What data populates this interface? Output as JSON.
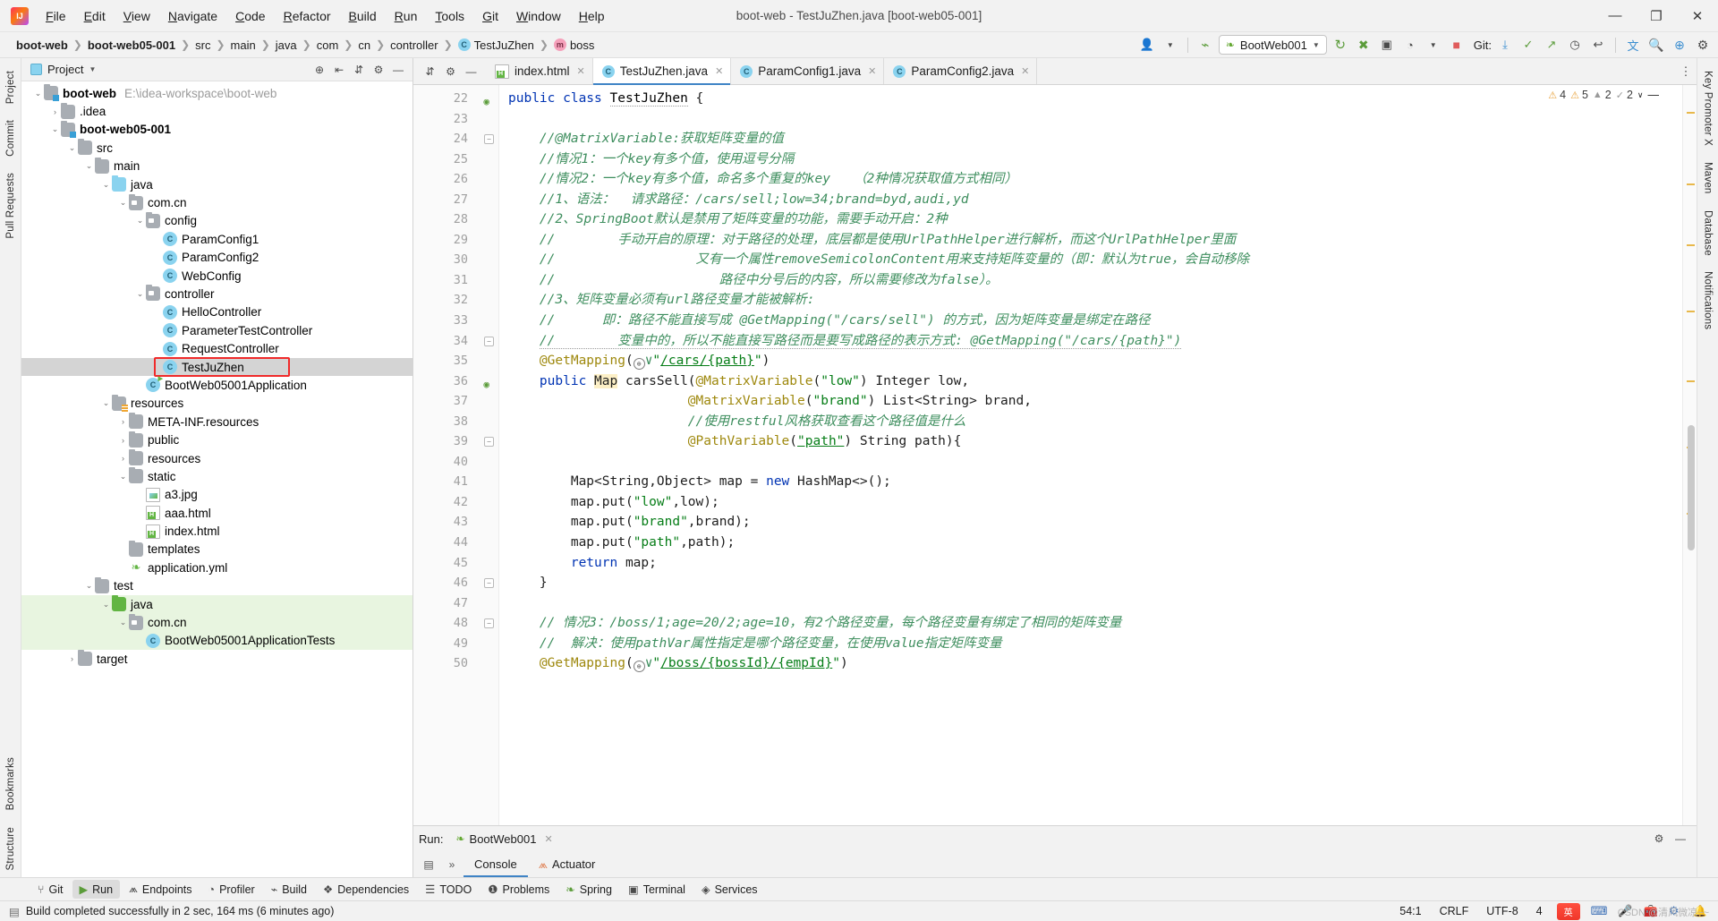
{
  "window": {
    "title": "boot-web - TestJuZhen.java [boot-web05-001]",
    "minimize": "—",
    "maximize": "❐",
    "close": "✕"
  },
  "menu": [
    "File",
    "Edit",
    "View",
    "Navigate",
    "Code",
    "Refactor",
    "Build",
    "Run",
    "Tools",
    "Git",
    "Window",
    "Help"
  ],
  "breadcrumb": [
    {
      "label": "boot-web",
      "bold": true,
      "icon": ""
    },
    {
      "label": "boot-web05-001",
      "bold": true,
      "icon": ""
    },
    {
      "label": "src",
      "bold": false,
      "icon": ""
    },
    {
      "label": "main",
      "bold": false,
      "icon": ""
    },
    {
      "label": "java",
      "bold": false,
      "icon": ""
    },
    {
      "label": "com",
      "bold": false,
      "icon": ""
    },
    {
      "label": "cn",
      "bold": false,
      "icon": ""
    },
    {
      "label": "controller",
      "bold": false,
      "icon": ""
    },
    {
      "label": "TestJuZhen",
      "bold": false,
      "icon": "class-icon"
    },
    {
      "label": "boss",
      "bold": false,
      "icon": "method-icon"
    }
  ],
  "toolbar": {
    "run_config": "BootWeb001",
    "git_label": "Git:",
    "icons": [
      "user-icon",
      "chevron-down-icon",
      "build-hammer-icon",
      "rerun-icon",
      "debug-icon",
      "run-with-coverage-icon",
      "profiler-icon",
      "chevron-down-icon",
      "stop-icon",
      "git-update-icon",
      "git-commit-icon",
      "git-push-icon",
      "history-icon",
      "rollback-icon",
      "translate-icon",
      "search-icon",
      "plugin-icon",
      "settings-icon"
    ]
  },
  "project_panel": {
    "title": "Project",
    "header_icons": [
      "target-icon",
      "collapse-all-icon",
      "expand-icon",
      "settings-icon",
      "hide-icon"
    ],
    "tree": [
      {
        "depth": 0,
        "arrow": "v",
        "icon": "module-folder",
        "label": "boot-web",
        "bold": true,
        "hint": "E:\\idea-workspace\\boot-web"
      },
      {
        "depth": 1,
        "arrow": ">",
        "icon": "folder",
        "label": ".idea",
        "bold": false,
        "hint": ""
      },
      {
        "depth": 1,
        "arrow": "v",
        "icon": "module-folder",
        "label": "boot-web05-001",
        "bold": true,
        "hint": ""
      },
      {
        "depth": 2,
        "arrow": "v",
        "icon": "folder",
        "label": "src",
        "bold": false,
        "hint": ""
      },
      {
        "depth": 3,
        "arrow": "v",
        "icon": "folder",
        "label": "main",
        "bold": false,
        "hint": ""
      },
      {
        "depth": 4,
        "arrow": "v",
        "icon": "source-folder",
        "label": "java",
        "bold": false,
        "hint": ""
      },
      {
        "depth": 5,
        "arrow": "v",
        "icon": "package",
        "label": "com.cn",
        "bold": false,
        "hint": ""
      },
      {
        "depth": 6,
        "arrow": "v",
        "icon": "package",
        "label": "config",
        "bold": false,
        "hint": ""
      },
      {
        "depth": 7,
        "arrow": "",
        "icon": "class",
        "label": "ParamConfig1",
        "bold": false,
        "hint": ""
      },
      {
        "depth": 7,
        "arrow": "",
        "icon": "class",
        "label": "ParamConfig2",
        "bold": false,
        "hint": ""
      },
      {
        "depth": 7,
        "arrow": "",
        "icon": "class",
        "label": "WebConfig",
        "bold": false,
        "hint": ""
      },
      {
        "depth": 6,
        "arrow": "v",
        "icon": "package",
        "label": "controller",
        "bold": false,
        "hint": ""
      },
      {
        "depth": 7,
        "arrow": "",
        "icon": "class",
        "label": "HelloController",
        "bold": false,
        "hint": ""
      },
      {
        "depth": 7,
        "arrow": "",
        "icon": "class",
        "label": "ParameterTestController",
        "bold": false,
        "hint": ""
      },
      {
        "depth": 7,
        "arrow": "",
        "icon": "class",
        "label": "RequestController",
        "bold": false,
        "hint": ""
      },
      {
        "depth": 7,
        "arrow": "",
        "icon": "class",
        "label": "TestJuZhen",
        "bold": false,
        "hint": "",
        "selected": true,
        "annotated": true
      },
      {
        "depth": 6,
        "arrow": "",
        "icon": "class-runnable",
        "label": "BootWeb05001Application",
        "bold": false,
        "hint": ""
      },
      {
        "depth": 4,
        "arrow": "v",
        "icon": "resource-folder",
        "label": "resources",
        "bold": false,
        "hint": ""
      },
      {
        "depth": 5,
        "arrow": ">",
        "icon": "folder",
        "label": "META-INF.resources",
        "bold": false,
        "hint": ""
      },
      {
        "depth": 5,
        "arrow": ">",
        "icon": "folder",
        "label": "public",
        "bold": false,
        "hint": ""
      },
      {
        "depth": 5,
        "arrow": ">",
        "icon": "folder",
        "label": "resources",
        "bold": false,
        "hint": ""
      },
      {
        "depth": 5,
        "arrow": "v",
        "icon": "folder",
        "label": "static",
        "bold": false,
        "hint": ""
      },
      {
        "depth": 6,
        "arrow": "",
        "icon": "image",
        "label": "a3.jpg",
        "bold": false,
        "hint": ""
      },
      {
        "depth": 6,
        "arrow": "",
        "icon": "html",
        "label": "aaa.html",
        "bold": false,
        "hint": ""
      },
      {
        "depth": 6,
        "arrow": "",
        "icon": "html",
        "label": "index.html",
        "bold": false,
        "hint": ""
      },
      {
        "depth": 5,
        "arrow": "",
        "icon": "folder",
        "label": "templates",
        "bold": false,
        "hint": ""
      },
      {
        "depth": 5,
        "arrow": "",
        "icon": "yml",
        "label": "application.yml",
        "bold": false,
        "hint": ""
      },
      {
        "depth": 3,
        "arrow": "v",
        "icon": "folder",
        "label": "test",
        "bold": false,
        "hint": ""
      },
      {
        "depth": 4,
        "arrow": "v",
        "icon": "test-folder",
        "label": "java",
        "bold": false,
        "hint": "",
        "greenbg": true
      },
      {
        "depth": 5,
        "arrow": "v",
        "icon": "package",
        "label": "com.cn",
        "bold": false,
        "hint": "",
        "greenbg": true
      },
      {
        "depth": 6,
        "arrow": "",
        "icon": "class",
        "label": "BootWeb05001ApplicationTests",
        "bold": false,
        "hint": "",
        "greenbg": true
      },
      {
        "depth": 2,
        "arrow": ">",
        "icon": "folder",
        "label": "target",
        "bold": false,
        "hint": ""
      }
    ]
  },
  "editor_tabs": [
    {
      "label": "index.html",
      "icon": "html-icon",
      "active": false
    },
    {
      "label": "TestJuZhen.java",
      "icon": "class-icon",
      "active": true
    },
    {
      "label": "ParamConfig1.java",
      "icon": "class-icon",
      "active": false
    },
    {
      "label": "ParamConfig2.java",
      "icon": "class-icon",
      "active": false
    }
  ],
  "inspections": {
    "warnings": "4",
    "weak_warnings": "5",
    "infos": "2",
    "typos": "2"
  },
  "code": {
    "first_line_number": 22,
    "lines": [
      {
        "n": 22,
        "gmark": "class-marker",
        "html": "<span class=\"kw\">public class </span><span class=\"cls2 wavy\">TestJuZhen</span> {"
      },
      {
        "n": 23,
        "html": ""
      },
      {
        "n": 24,
        "fold": "-",
        "html": "    <span class=\"cmt\">//@MatrixVariable:获取矩阵变量的值</span>"
      },
      {
        "n": 25,
        "html": "    <span class=\"cmt\">//情况1：一个key有多个值，使用逗号分隔</span>"
      },
      {
        "n": 26,
        "html": "    <span class=\"cmt\">//情况2：一个key有多个值，命名多个重复的key   （2种情况获取值方式相同）</span>"
      },
      {
        "n": 27,
        "html": "    <span class=\"cmt\">//1、语法：  请求路径：/cars/sell;low=34;brand=byd,audi,yd</span>"
      },
      {
        "n": 28,
        "html": "    <span class=\"cmt\">//2、SpringBoot默认是禁用了矩阵变量的功能，需要手动开启：2种</span>"
      },
      {
        "n": 29,
        "html": "    <span class=\"cmt\">//        手动开启的原理：对于路径的处理，底层都是使用UrlPathHelper进行解析，而这个UrlPathHelper里面</span>"
      },
      {
        "n": 30,
        "html": "    <span class=\"cmt\">//                  又有一个属性removeSemicolonContent用来支持矩阵变量的（即：默认为true，会自动移除</span>"
      },
      {
        "n": 31,
        "html": "    <span class=\"cmt\">//                     路径中分号后的内容，所以需要修改为false）。</span>"
      },
      {
        "n": 32,
        "html": "    <span class=\"cmt\">//3、矩阵变量必须有url路径变量才能被解析:</span>"
      },
      {
        "n": 33,
        "html": "    <span class=\"cmt\">//      即：路径不能直接写成 @GetMapping(\"/cars/sell\") 的方式，因为矩阵变量是绑定在路径</span>"
      },
      {
        "n": 34,
        "fold": "-",
        "html": "    <span class=\"cmt wavy\">//        变量中的，所以不能直接写路径而是要写成路径的表示方式: @GetMapping(\"/cars/{path}\")</span>"
      },
      {
        "n": 35,
        "html": "    <span class=\"anno\">@GetMapping</span>(<span class=\"globe\">⊕</span><span class=\"cmt\">∨</span><span class=\"str\">\"</span><span class=\"str ulink\">/cars/{path}</span><span class=\"str\">\"</span>)"
      },
      {
        "n": 36,
        "gmark": "globe-marker",
        "html": "    <span class=\"kw\">public </span><span class=\"hl\">Map</span> carsSell(<span class=\"anno\">@MatrixVariable</span>(<span class=\"str\">\"low\"</span>) Integer low,"
      },
      {
        "n": 37,
        "html": "                       <span class=\"anno\">@MatrixVariable</span>(<span class=\"str\">\"brand\"</span>) List&lt;String&gt; brand,"
      },
      {
        "n": 38,
        "html": "                       <span class=\"cmt\">//使用restful风格获取查看这个路径值是什么</span>"
      },
      {
        "n": 39,
        "fold": "-",
        "html": "                       <span class=\"anno\">@PathVariable</span>(<span class=\"str ulink\">\"path\"</span>) String path){"
      },
      {
        "n": 40,
        "html": ""
      },
      {
        "n": 41,
        "html": "        Map&lt;String,Object&gt; map = <span class=\"kw\">new </span>HashMap&lt;&gt;();"
      },
      {
        "n": 42,
        "html": "        map.put(<span class=\"str\">\"low\"</span>,low);"
      },
      {
        "n": 43,
        "html": "        map.put(<span class=\"str\">\"brand\"</span>,brand);"
      },
      {
        "n": 44,
        "html": "        map.put(<span class=\"str\">\"path\"</span>,path);"
      },
      {
        "n": 45,
        "html": "        <span class=\"kw\">return </span>map;"
      },
      {
        "n": 46,
        "fold": "-",
        "html": "    }"
      },
      {
        "n": 47,
        "html": ""
      },
      {
        "n": 48,
        "fold": "-",
        "html": "    <span class=\"cmt\">// 情况3：/boss/1;age=20/2;age=10，有2个路径变量，每个路径变量有绑定了相同的矩阵变量</span>"
      },
      {
        "n": 49,
        "html": "    <span class=\"cmt\">//  解决：使用pathVar属性指定是哪个路径变量，在使用value指定矩阵变量</span>"
      },
      {
        "n": 50,
        "html": "    <span class=\"anno\">@GetMapping</span>(<span class=\"globe\">⊕</span><span class=\"cmt\">∨</span><span class=\"str\">\"</span><span class=\"str ulink\">/boss/{bossId}/{empId}</span><span class=\"str\">\"</span>)"
      }
    ]
  },
  "run_panel": {
    "label": "Run:",
    "config_name": "BootWeb001",
    "tabs": [
      {
        "label": "Console",
        "icon": "",
        "active": true
      },
      {
        "label": "Actuator",
        "icon": "actuator-icon",
        "active": false
      }
    ]
  },
  "tool_strip": [
    {
      "label": "Git",
      "icon": "git-icon",
      "active": false
    },
    {
      "label": "Run",
      "icon": "run-icon",
      "active": true
    },
    {
      "label": "Endpoints",
      "icon": "endpoints-icon",
      "active": false
    },
    {
      "label": "Profiler",
      "icon": "profiler-icon",
      "active": false
    },
    {
      "label": "Build",
      "icon": "build-icon",
      "active": false
    },
    {
      "label": "Dependencies",
      "icon": "dependencies-icon",
      "active": false
    },
    {
      "label": "TODO",
      "icon": "todo-icon",
      "active": false
    },
    {
      "label": "Problems",
      "icon": "problems-icon",
      "active": false
    },
    {
      "label": "Spring",
      "icon": "spring-icon",
      "active": false
    },
    {
      "label": "Terminal",
      "icon": "terminal-icon",
      "active": false
    },
    {
      "label": "Services",
      "icon": "services-icon",
      "active": false
    }
  ],
  "left_bar": [
    "Project",
    "Commit",
    "Pull Requests",
    "Bookmarks",
    "Structure"
  ],
  "right_bar": [
    "Key Promoter X",
    "Maven",
    "Database",
    "Notifications"
  ],
  "status_bar": {
    "message": "Build completed successfully in 2 sec, 164 ms (6 minutes ago)",
    "caret": "54:1",
    "line_sep": "CRLF",
    "encoding": "UTF-8",
    "indent": "4",
    "ime_label": "英",
    "watermark": "CSDN @清风微凉~~"
  }
}
